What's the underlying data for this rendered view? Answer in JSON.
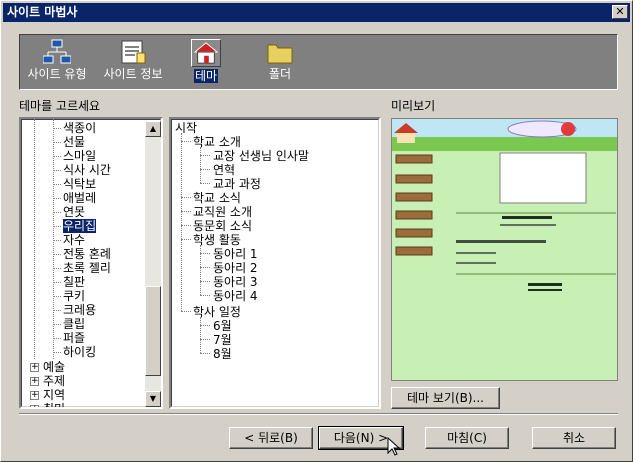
{
  "window": {
    "title": "사이트 마법사",
    "close_glyph": "✕"
  },
  "toolbar": {
    "items": [
      {
        "label": "사이트 유형",
        "icon": "network-icon"
      },
      {
        "label": "사이트 정보",
        "icon": "document-icon"
      },
      {
        "label": "테마",
        "icon": "home-icon",
        "selected": true
      },
      {
        "label": "폴더",
        "icon": "folder-icon"
      }
    ]
  },
  "theme_panel": {
    "label": "테마를 고르세요",
    "items": [
      "색종이",
      "선물",
      "스마일",
      "식사 시간",
      "식탁보",
      "애벌레",
      "연못",
      "우리집",
      "자수",
      "전통 혼례",
      "초록 젤리",
      "칠판",
      "쿠키",
      "크레용",
      "클립",
      "퍼즐",
      "하이킹"
    ],
    "selected": "우리집",
    "categories": [
      "예술",
      "주제",
      "지역",
      "취미"
    ]
  },
  "structure_panel": {
    "root": "시작",
    "groups": [
      {
        "label": "학교 소개",
        "children": [
          "교장 선생님 인사말",
          "연혁",
          "교과 과정"
        ]
      },
      {
        "label": "학교 소식",
        "children": []
      },
      {
        "label": "교직원 소개",
        "children": []
      },
      {
        "label": "동문회 소식",
        "children": []
      },
      {
        "label": "학생 활동",
        "children": [
          "동아리 1",
          "동아리 2",
          "동아리 3",
          "동아리 4"
        ]
      },
      {
        "label": "학사 일정",
        "children": [
          "6월",
          "7월",
          "8월"
        ]
      }
    ]
  },
  "preview": {
    "label": "미리보기",
    "view_button": "테마 보기(B)..."
  },
  "footer": {
    "back": "< 뒤로(B)",
    "next": "다음(N) >",
    "finish": "마침(C)",
    "cancel": "취소"
  }
}
